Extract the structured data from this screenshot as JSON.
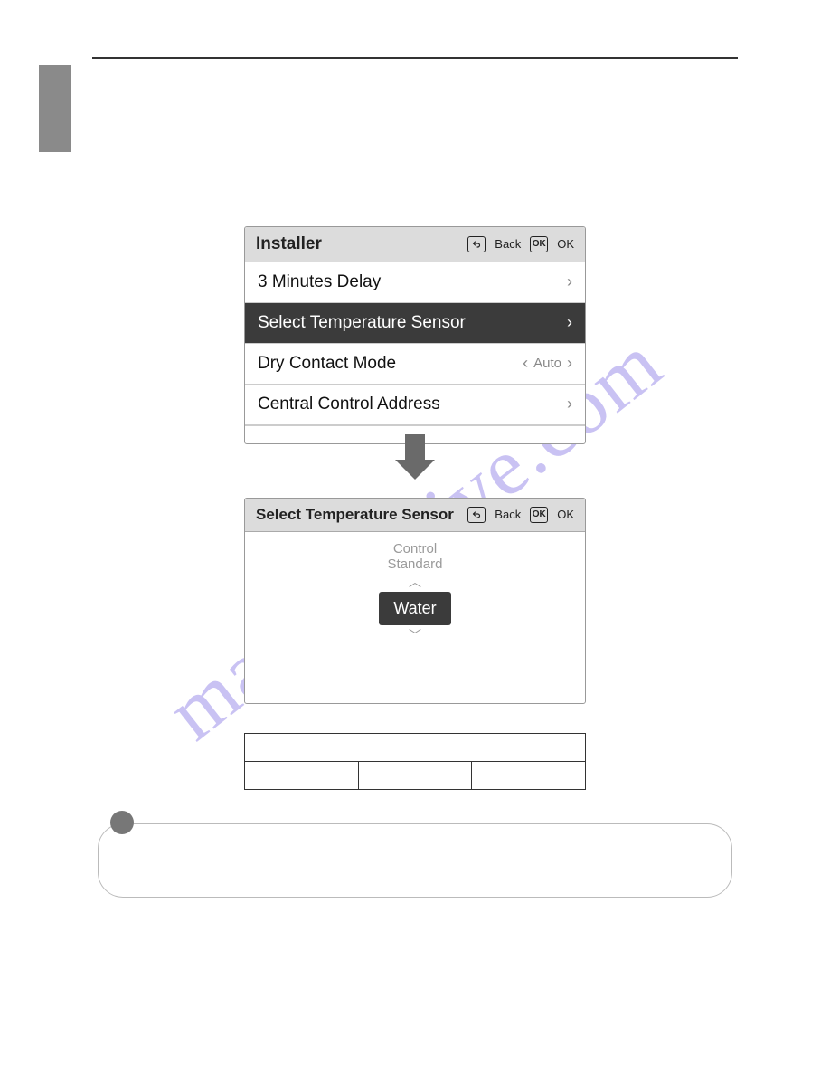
{
  "watermark": "manualshive.com",
  "panel1": {
    "title": "Installer",
    "back_label": "Back",
    "ok_label": "OK",
    "rows": [
      {
        "label": "3 Minutes Delay"
      },
      {
        "label": "Select Temperature Sensor"
      },
      {
        "label": "Dry Contact Mode",
        "value": "Auto"
      },
      {
        "label": "Central Control Address"
      }
    ]
  },
  "panel2": {
    "title": "Select Temperature Sensor",
    "back_label": "Back",
    "ok_label": "OK",
    "control_standard_line1": "Control",
    "control_standard_line2": "Standard",
    "selected_value": "Water"
  },
  "icons": {
    "ok_text": "OK"
  }
}
